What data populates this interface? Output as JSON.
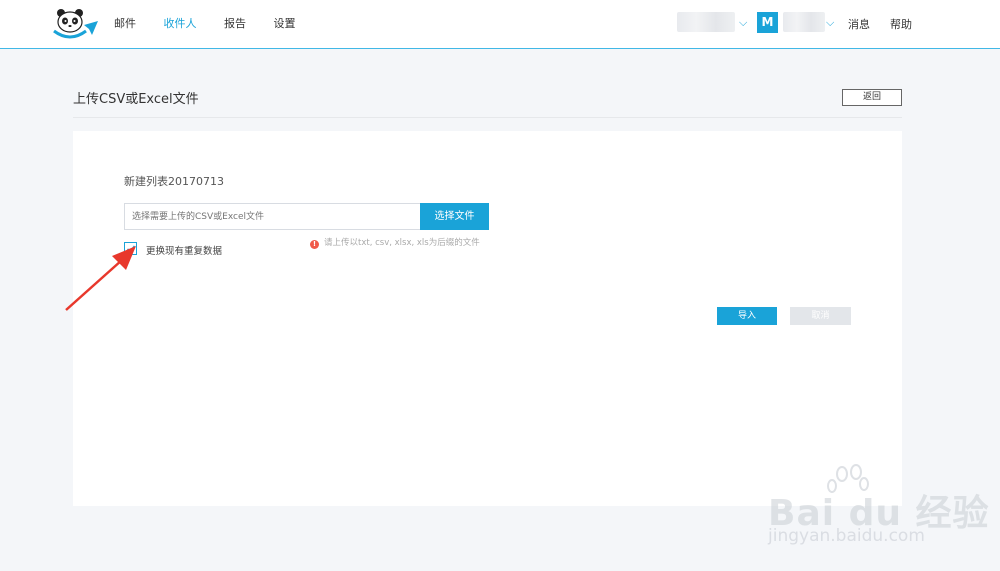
{
  "nav": {
    "items": [
      {
        "label": "邮件",
        "active": false
      },
      {
        "label": "收件人",
        "active": true
      },
      {
        "label": "报告",
        "active": false
      },
      {
        "label": "设置",
        "active": false
      }
    ]
  },
  "header": {
    "avatar_letter": "M",
    "messages": "消息",
    "help": "帮助"
  },
  "page": {
    "title": "上传CSV或Excel文件",
    "back_label": "返回"
  },
  "upload": {
    "list_name": "新建列表20170713",
    "file_placeholder": "选择需要上传的CSV或Excel文件",
    "choose_label": "选择文件",
    "hint": "请上传以txt, csv, xlsx, xls为后缀的文件",
    "replace_label": "更换现有重复数据",
    "replace_checked": true,
    "import_label": "导入",
    "cancel_label": "取消"
  },
  "colors": {
    "accent": "#1aa3d8",
    "warning": "#f05a4a",
    "arrow": "#e8382c"
  }
}
